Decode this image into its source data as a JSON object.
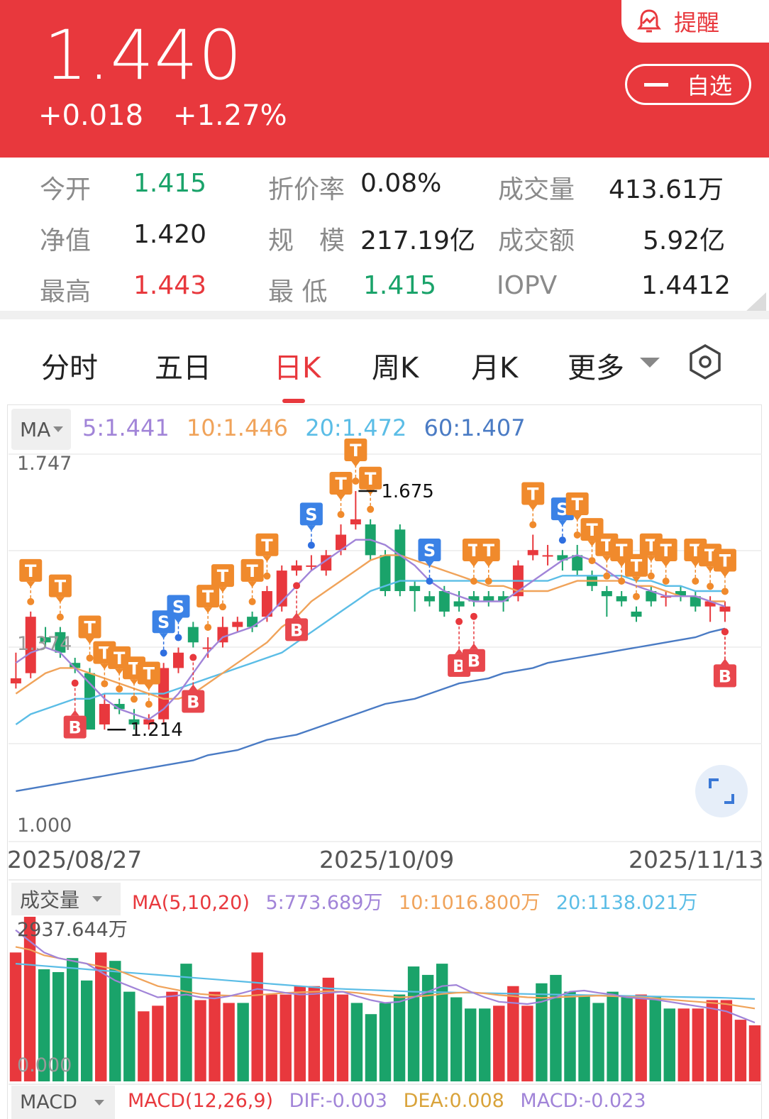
{
  "header": {
    "price": "1.440",
    "change": "+0.018",
    "change_pct": "+1.27%",
    "alert_label": "提醒",
    "watchlist_label": "自选"
  },
  "stats": [
    {
      "label": "今开",
      "value": "1.415",
      "tone": "down"
    },
    {
      "label": "折价率",
      "value": "0.08%",
      "tone": "flat"
    },
    {
      "label": "成交量",
      "value": "413.61万",
      "tone": "flat"
    },
    {
      "label": "净值",
      "value": "1.420",
      "tone": "flat"
    },
    {
      "label": "规　模",
      "value": "217.19亿",
      "tone": "flat"
    },
    {
      "label": "成交额",
      "value": "5.92亿",
      "tone": "flat"
    },
    {
      "label": "最高",
      "value": "1.443",
      "tone": "up"
    },
    {
      "label": "最 低",
      "value": "1.415",
      "tone": "down"
    },
    {
      "label": "IOPV",
      "value": "1.4412",
      "tone": "flat"
    }
  ],
  "tabs": [
    "分时",
    "五日",
    "日K",
    "周K",
    "月K",
    "更多"
  ],
  "active_tab": "日K",
  "colors": {
    "up": "#e8383d",
    "down": "#1aa36a",
    "ma5": "#a184d8",
    "ma10": "#f0a35a",
    "ma20": "#5bbde6",
    "ma60": "#4a7bc4"
  },
  "ma": {
    "button": "MA",
    "ma5": "5:1.441",
    "ma10": "10:1.446",
    "ma20": "20:1.472",
    "ma60": "60:1.407"
  },
  "price_axis": {
    "top": "1.747",
    "bottom": "1.000",
    "mid_label": "1.374"
  },
  "annotations": {
    "high": "1.675",
    "low": "1.214"
  },
  "dates": [
    "2025/08/27",
    "2025/10/09",
    "2025/11/13"
  ],
  "volume": {
    "button": "成交量",
    "legend_title": "MA(5,10,20)",
    "ma5": "5:773.689万",
    "ma10": "10:1016.800万",
    "ma20": "20:1138.021万",
    "max_label": "2937.644万",
    "zero_label": "0.000"
  },
  "macd": {
    "button": "MACD",
    "title": "MACD(12,26,9)",
    "dif": "DIF:-0.003",
    "dea": "DEA:0.008",
    "macd": "MACD:-0.023"
  },
  "chart_data": {
    "type": "candlestick",
    "ylim": [
      1.0,
      1.747
    ],
    "candles": [
      {
        "o": 1.3,
        "c": 1.31,
        "h": 1.36,
        "l": 1.29
      },
      {
        "o": 1.32,
        "c": 1.43,
        "h": 1.44,
        "l": 1.31
      },
      {
        "o": 1.39,
        "c": 1.38,
        "h": 1.41,
        "l": 1.37
      },
      {
        "o": 1.4,
        "c": 1.36,
        "h": 1.41,
        "l": 1.35
      },
      {
        "o": 1.34,
        "c": 1.33,
        "h": 1.35,
        "l": 1.32
      },
      {
        "o": 1.32,
        "c": 1.21,
        "h": 1.33,
        "l": 1.214
      },
      {
        "o": 1.22,
        "c": 1.26,
        "h": 1.28,
        "l": 1.21
      },
      {
        "o": 1.26,
        "c": 1.25,
        "h": 1.27,
        "l": 1.24
      },
      {
        "o": 1.23,
        "c": 1.22,
        "h": 1.25,
        "l": 1.21
      },
      {
        "o": 1.22,
        "c": 1.23,
        "h": 1.24,
        "l": 1.21
      },
      {
        "o": 1.23,
        "c": 1.33,
        "h": 1.34,
        "l": 1.22
      },
      {
        "o": 1.33,
        "c": 1.36,
        "h": 1.37,
        "l": 1.32
      },
      {
        "o": 1.41,
        "c": 1.38,
        "h": 1.42,
        "l": 1.37
      },
      {
        "o": 1.37,
        "c": 1.37,
        "h": 1.39,
        "l": 1.35
      },
      {
        "o": 1.38,
        "c": 1.41,
        "h": 1.43,
        "l": 1.37
      },
      {
        "o": 1.41,
        "c": 1.42,
        "h": 1.43,
        "l": 1.4
      },
      {
        "o": 1.43,
        "c": 1.41,
        "h": 1.44,
        "l": 1.4
      },
      {
        "o": 1.43,
        "c": 1.48,
        "h": 1.49,
        "l": 1.42
      },
      {
        "o": 1.45,
        "c": 1.52,
        "h": 1.53,
        "l": 1.44
      },
      {
        "o": 1.52,
        "c": 1.53,
        "h": 1.54,
        "l": 1.51
      },
      {
        "o": 1.53,
        "c": 1.53,
        "h": 1.55,
        "l": 1.52
      },
      {
        "o": 1.52,
        "c": 1.55,
        "h": 1.56,
        "l": 1.51
      },
      {
        "o": 1.56,
        "c": 1.59,
        "h": 1.61,
        "l": 1.55
      },
      {
        "o": 1.61,
        "c": 1.62,
        "h": 1.675,
        "l": 1.6
      },
      {
        "o": 1.61,
        "c": 1.55,
        "h": 1.62,
        "l": 1.54
      },
      {
        "o": 1.55,
        "c": 1.48,
        "h": 1.56,
        "l": 1.47
      },
      {
        "o": 1.6,
        "c": 1.48,
        "h": 1.61,
        "l": 1.47
      },
      {
        "o": 1.49,
        "c": 1.48,
        "h": 1.5,
        "l": 1.44
      },
      {
        "o": 1.47,
        "c": 1.46,
        "h": 1.48,
        "l": 1.45
      },
      {
        "o": 1.48,
        "c": 1.44,
        "h": 1.49,
        "l": 1.43
      },
      {
        "o": 1.46,
        "c": 1.45,
        "h": 1.48,
        "l": 1.44
      },
      {
        "o": 1.47,
        "c": 1.46,
        "h": 1.48,
        "l": 1.45
      },
      {
        "o": 1.47,
        "c": 1.46,
        "h": 1.48,
        "l": 1.45
      },
      {
        "o": 1.47,
        "c": 1.46,
        "h": 1.48,
        "l": 1.44
      },
      {
        "o": 1.47,
        "c": 1.53,
        "h": 1.54,
        "l": 1.46
      },
      {
        "o": 1.55,
        "c": 1.56,
        "h": 1.59,
        "l": 1.54
      },
      {
        "o": 1.55,
        "c": 1.55,
        "h": 1.57,
        "l": 1.53
      },
      {
        "o": 1.55,
        "c": 1.54,
        "h": 1.56,
        "l": 1.52
      },
      {
        "o": 1.55,
        "c": 1.52,
        "h": 1.57,
        "l": 1.51
      },
      {
        "o": 1.51,
        "c": 1.49,
        "h": 1.52,
        "l": 1.48
      },
      {
        "o": 1.48,
        "c": 1.47,
        "h": 1.49,
        "l": 1.43
      },
      {
        "o": 1.47,
        "c": 1.46,
        "h": 1.48,
        "l": 1.45
      },
      {
        "o": 1.44,
        "c": 1.43,
        "h": 1.45,
        "l": 1.42
      },
      {
        "o": 1.48,
        "c": 1.46,
        "h": 1.49,
        "l": 1.45
      },
      {
        "o": 1.47,
        "c": 1.47,
        "h": 1.48,
        "l": 1.45
      },
      {
        "o": 1.48,
        "c": 1.47,
        "h": 1.49,
        "l": 1.46
      },
      {
        "o": 1.47,
        "c": 1.45,
        "h": 1.48,
        "l": 1.44
      },
      {
        "o": 1.45,
        "c": 1.46,
        "h": 1.47,
        "l": 1.42
      },
      {
        "o": 1.44,
        "c": 1.45,
        "h": 1.46,
        "l": 1.42
      }
    ],
    "ma5": [
      1.34,
      1.36,
      1.37,
      1.36,
      1.33,
      1.3,
      1.27,
      1.25,
      1.24,
      1.23,
      1.25,
      1.28,
      1.32,
      1.36,
      1.39,
      1.4,
      1.41,
      1.43,
      1.46,
      1.49,
      1.52,
      1.54,
      1.56,
      1.58,
      1.58,
      1.57,
      1.55,
      1.53,
      1.5,
      1.48,
      1.47,
      1.46,
      1.46,
      1.46,
      1.48,
      1.5,
      1.52,
      1.54,
      1.55,
      1.54,
      1.52,
      1.5,
      1.49,
      1.48,
      1.47,
      1.47,
      1.47,
      1.46,
      1.45
    ],
    "ma10": [
      1.28,
      1.3,
      1.32,
      1.33,
      1.33,
      1.32,
      1.31,
      1.3,
      1.29,
      1.28,
      1.27,
      1.27,
      1.28,
      1.3,
      1.32,
      1.34,
      1.36,
      1.38,
      1.41,
      1.43,
      1.46,
      1.48,
      1.5,
      1.52,
      1.54,
      1.55,
      1.55,
      1.54,
      1.53,
      1.52,
      1.51,
      1.5,
      1.49,
      1.49,
      1.48,
      1.48,
      1.48,
      1.49,
      1.5,
      1.5,
      1.5,
      1.5,
      1.49,
      1.49,
      1.48,
      1.47,
      1.47,
      1.46,
      1.46
    ],
    "ma20": [
      1.22,
      1.24,
      1.25,
      1.26,
      1.27,
      1.27,
      1.28,
      1.28,
      1.28,
      1.28,
      1.28,
      1.29,
      1.3,
      1.31,
      1.32,
      1.33,
      1.34,
      1.35,
      1.36,
      1.38,
      1.4,
      1.42,
      1.44,
      1.46,
      1.48,
      1.49,
      1.5,
      1.5,
      1.5,
      1.5,
      1.5,
      1.5,
      1.5,
      1.5,
      1.5,
      1.5,
      1.5,
      1.51,
      1.51,
      1.51,
      1.51,
      1.51,
      1.5,
      1.5,
      1.49,
      1.49,
      1.48,
      1.48,
      1.48
    ],
    "ma60": [
      1.09,
      1.095,
      1.1,
      1.105,
      1.11,
      1.115,
      1.12,
      1.125,
      1.13,
      1.135,
      1.14,
      1.145,
      1.15,
      1.16,
      1.165,
      1.17,
      1.18,
      1.19,
      1.195,
      1.2,
      1.21,
      1.22,
      1.23,
      1.24,
      1.25,
      1.26,
      1.265,
      1.27,
      1.28,
      1.29,
      1.3,
      1.305,
      1.31,
      1.32,
      1.325,
      1.33,
      1.34,
      1.345,
      1.35,
      1.355,
      1.36,
      1.365,
      1.37,
      1.375,
      1.38,
      1.385,
      1.39,
      1.4,
      1.407
    ],
    "signals": [
      {
        "i": 1,
        "label": "T",
        "pos": "above"
      },
      {
        "i": 3,
        "label": "T",
        "pos": "above"
      },
      {
        "i": 5,
        "label": "T",
        "pos": "above"
      },
      {
        "i": 6,
        "label": "T",
        "pos": "above"
      },
      {
        "i": 7,
        "label": "T",
        "pos": "above"
      },
      {
        "i": 8,
        "label": "T",
        "pos": "above"
      },
      {
        "i": 9,
        "label": "T",
        "pos": "above"
      },
      {
        "i": 10,
        "label": "S",
        "pos": "above"
      },
      {
        "i": 11,
        "label": "S",
        "pos": "above"
      },
      {
        "i": 13,
        "label": "T",
        "pos": "above"
      },
      {
        "i": 14,
        "label": "T",
        "pos": "above"
      },
      {
        "i": 16,
        "label": "T",
        "pos": "above"
      },
      {
        "i": 17,
        "label": "T",
        "pos": "above"
      },
      {
        "i": 20,
        "label": "S",
        "pos": "above"
      },
      {
        "i": 22,
        "label": "T",
        "pos": "above"
      },
      {
        "i": 23,
        "label": "T",
        "pos": "above"
      },
      {
        "i": 24,
        "label": "T",
        "pos": "above"
      },
      {
        "i": 28,
        "label": "S",
        "pos": "above"
      },
      {
        "i": 31,
        "label": "T",
        "pos": "above"
      },
      {
        "i": 32,
        "label": "T",
        "pos": "above"
      },
      {
        "i": 35,
        "label": "T",
        "pos": "above"
      },
      {
        "i": 37,
        "label": "S",
        "pos": "above"
      },
      {
        "i": 38,
        "label": "T",
        "pos": "above"
      },
      {
        "i": 39,
        "label": "T",
        "pos": "above"
      },
      {
        "i": 40,
        "label": "T",
        "pos": "above"
      },
      {
        "i": 41,
        "label": "T",
        "pos": "above"
      },
      {
        "i": 42,
        "label": "T",
        "pos": "above"
      },
      {
        "i": 43,
        "label": "T",
        "pos": "above"
      },
      {
        "i": 44,
        "label": "T",
        "pos": "above"
      },
      {
        "i": 46,
        "label": "T",
        "pos": "above"
      },
      {
        "i": 47,
        "label": "T",
        "pos": "above"
      },
      {
        "i": 49,
        "label": "T",
        "pos": "above"
      },
      {
        "i": 4,
        "label": "B",
        "pos": "below"
      },
      {
        "i": 12,
        "label": "B",
        "pos": "below"
      },
      {
        "i": 19,
        "label": "B",
        "pos": "below"
      },
      {
        "i": 30,
        "label": "B",
        "pos": "below"
      },
      {
        "i": 31,
        "label": "B",
        "pos": "below"
      },
      {
        "i": 48,
        "label": "B",
        "pos": "below"
      },
      {
        "i": 50,
        "label": "B",
        "pos": "below"
      }
    ],
    "volumes": [
      2300,
      2937,
      2000,
      1950,
      2200,
      1800,
      2300,
      2150,
      1600,
      1250,
      1350,
      1600,
      2100,
      1450,
      1600,
      1400,
      1400,
      2300,
      1550,
      1550,
      1700,
      1700,
      1850,
      1550,
      1400,
      1200,
      1400,
      1550,
      2050,
      1900,
      2100,
      1500,
      1300,
      1300,
      1350,
      1700,
      1350,
      1750,
      1900,
      1600,
      1550,
      1400,
      1600,
      1500,
      1550,
      1500,
      1300,
      1300,
      1300,
      1450,
      1450,
      1100,
      1000
    ],
    "vol_ma5": [
      2700,
      2500,
      2300,
      2200,
      2150,
      2100,
      1950,
      1800,
      1700,
      1600,
      1500,
      1520,
      1550,
      1500,
      1480,
      1520,
      1580,
      1650,
      1620,
      1580,
      1550,
      1560,
      1580,
      1600,
      1520,
      1450,
      1400,
      1420,
      1500,
      1600,
      1700,
      1720,
      1600,
      1500,
      1420,
      1400,
      1380,
      1420,
      1500,
      1600,
      1620,
      1580,
      1550,
      1500,
      1480,
      1460,
      1420,
      1380,
      1340,
      1300,
      1250,
      1150,
      1050
    ],
    "vol_ma10": [
      2400,
      2350,
      2250,
      2200,
      2150,
      2100,
      2050,
      2000,
      1900,
      1800,
      1700,
      1650,
      1600,
      1560,
      1540,
      1530,
      1520,
      1540,
      1560,
      1580,
      1590,
      1600,
      1610,
      1600,
      1580,
      1550,
      1520,
      1500,
      1510,
      1530,
      1560,
      1580,
      1590,
      1570,
      1540,
      1520,
      1500,
      1490,
      1500,
      1510,
      1520,
      1530,
      1520,
      1510,
      1500,
      1480,
      1460,
      1440,
      1420,
      1400,
      1380,
      1340,
      1300
    ],
    "vol_ma20": [
      2100,
      2080,
      2060,
      2040,
      2020,
      2000,
      1980,
      1960,
      1940,
      1920,
      1900,
      1880,
      1860,
      1840,
      1820,
      1800,
      1780,
      1760,
      1740,
      1720,
      1700,
      1680,
      1660,
      1650,
      1640,
      1630,
      1620,
      1610,
      1600,
      1595,
      1590,
      1585,
      1580,
      1575,
      1570,
      1565,
      1560,
      1555,
      1550,
      1545,
      1540,
      1535,
      1530,
      1525,
      1520,
      1515,
      1510,
      1505,
      1500,
      1495,
      1490,
      1480,
      1470
    ]
  }
}
